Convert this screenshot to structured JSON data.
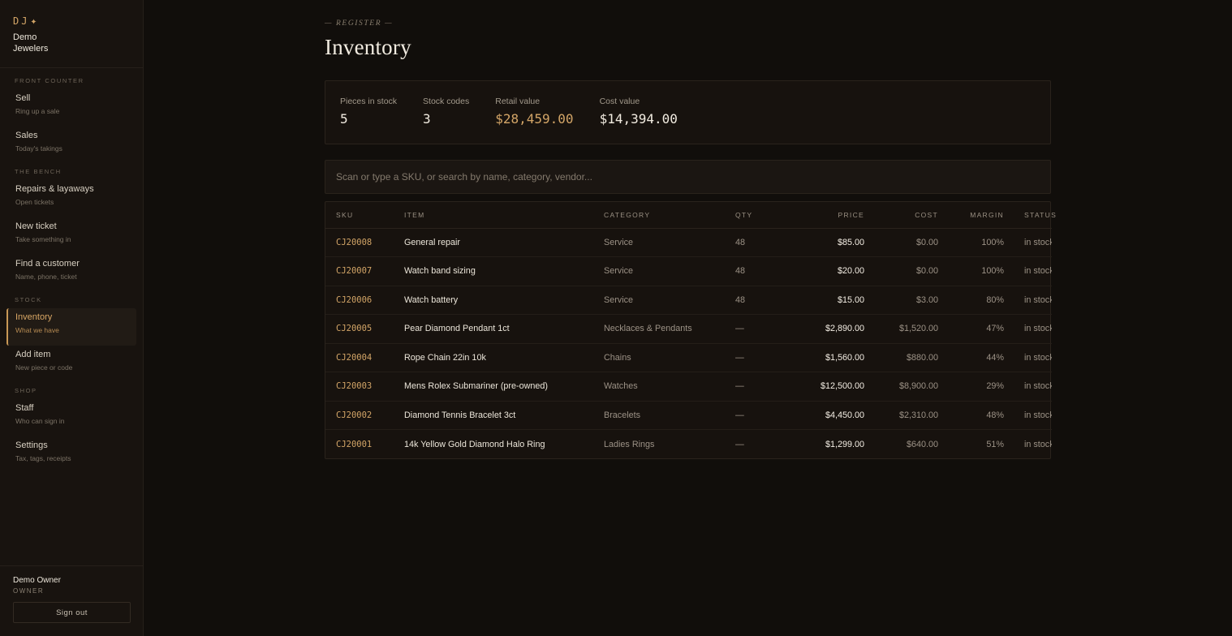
{
  "brand": {
    "mark": "DJ",
    "star": "✦",
    "name": "Demo Jewelers"
  },
  "nav": {
    "sections": [
      {
        "title": "FRONT COUNTER",
        "items": [
          {
            "label": "Sell",
            "sub": "Ring up a sale"
          },
          {
            "label": "Sales",
            "sub": "Today's takings"
          }
        ]
      },
      {
        "title": "THE BENCH",
        "items": [
          {
            "label": "Repairs & layaways",
            "sub": "Open tickets"
          },
          {
            "label": "New ticket",
            "sub": "Take something in"
          },
          {
            "label": "Find a customer",
            "sub": "Name, phone, ticket"
          }
        ]
      },
      {
        "title": "STOCK",
        "items": [
          {
            "label": "Inventory",
            "sub": "What we have"
          },
          {
            "label": "Add item",
            "sub": "New piece or code"
          }
        ]
      },
      {
        "title": "SHOP",
        "items": [
          {
            "label": "Staff",
            "sub": "Who can sign in"
          },
          {
            "label": "Settings",
            "sub": "Tax, tags, receipts"
          }
        ]
      }
    ]
  },
  "user": {
    "name": "Demo Owner",
    "role": "OWNER",
    "signout_label": "Sign out"
  },
  "page": {
    "eyebrow": "— REGISTER —",
    "title": "Inventory"
  },
  "stats": {
    "pieces_label": "Pieces in stock",
    "pieces_value": "5",
    "codes_label": "Stock codes",
    "codes_value": "3",
    "retail_label": "Retail value",
    "retail_value": "$28,459.00",
    "cost_label": "Cost value",
    "cost_value": "$14,394.00"
  },
  "search": {
    "placeholder": "Scan or type a SKU, or search by name, category, vendor..."
  },
  "table": {
    "headers": {
      "sku": "SKU",
      "item": "ITEM",
      "category": "CATEGORY",
      "qty": "QTY",
      "price": "PRICE",
      "cost": "COST",
      "margin": "MARGIN",
      "status": "STATUS"
    },
    "rows": [
      {
        "sku": "CJ20008",
        "item": "General repair",
        "category": "Service",
        "qty": "48",
        "price": "$85.00",
        "cost": "$0.00",
        "margin": "100%",
        "status": "in stock"
      },
      {
        "sku": "CJ20007",
        "item": "Watch band sizing",
        "category": "Service",
        "qty": "48",
        "price": "$20.00",
        "cost": "$0.00",
        "margin": "100%",
        "status": "in stock"
      },
      {
        "sku": "CJ20006",
        "item": "Watch battery",
        "category": "Service",
        "qty": "48",
        "price": "$15.00",
        "cost": "$3.00",
        "margin": "80%",
        "status": "in stock"
      },
      {
        "sku": "CJ20005",
        "item": "Pear Diamond Pendant 1ct",
        "category": "Necklaces & Pendants",
        "qty": "—",
        "price": "$2,890.00",
        "cost": "$1,520.00",
        "margin": "47%",
        "status": "in stock"
      },
      {
        "sku": "CJ20004",
        "item": "Rope Chain 22in 10k",
        "category": "Chains",
        "qty": "—",
        "price": "$1,560.00",
        "cost": "$880.00",
        "margin": "44%",
        "status": "in stock"
      },
      {
        "sku": "CJ20003",
        "item": "Mens Rolex Submariner (pre-owned)",
        "category": "Watches",
        "qty": "—",
        "price": "$12,500.00",
        "cost": "$8,900.00",
        "margin": "29%",
        "status": "in stock"
      },
      {
        "sku": "CJ20002",
        "item": "Diamond Tennis Bracelet 3ct",
        "category": "Bracelets",
        "qty": "—",
        "price": "$4,450.00",
        "cost": "$2,310.00",
        "margin": "48%",
        "status": "in stock"
      },
      {
        "sku": "CJ20001",
        "item": "14k Yellow Gold Diamond Halo Ring",
        "category": "Ladies Rings",
        "qty": "—",
        "price": "$1,299.00",
        "cost": "$640.00",
        "margin": "51%",
        "status": "in stock"
      }
    ]
  },
  "colors": {
    "accent": "#d3a567",
    "background": "#110e0b",
    "sidebar": "#18130f"
  }
}
